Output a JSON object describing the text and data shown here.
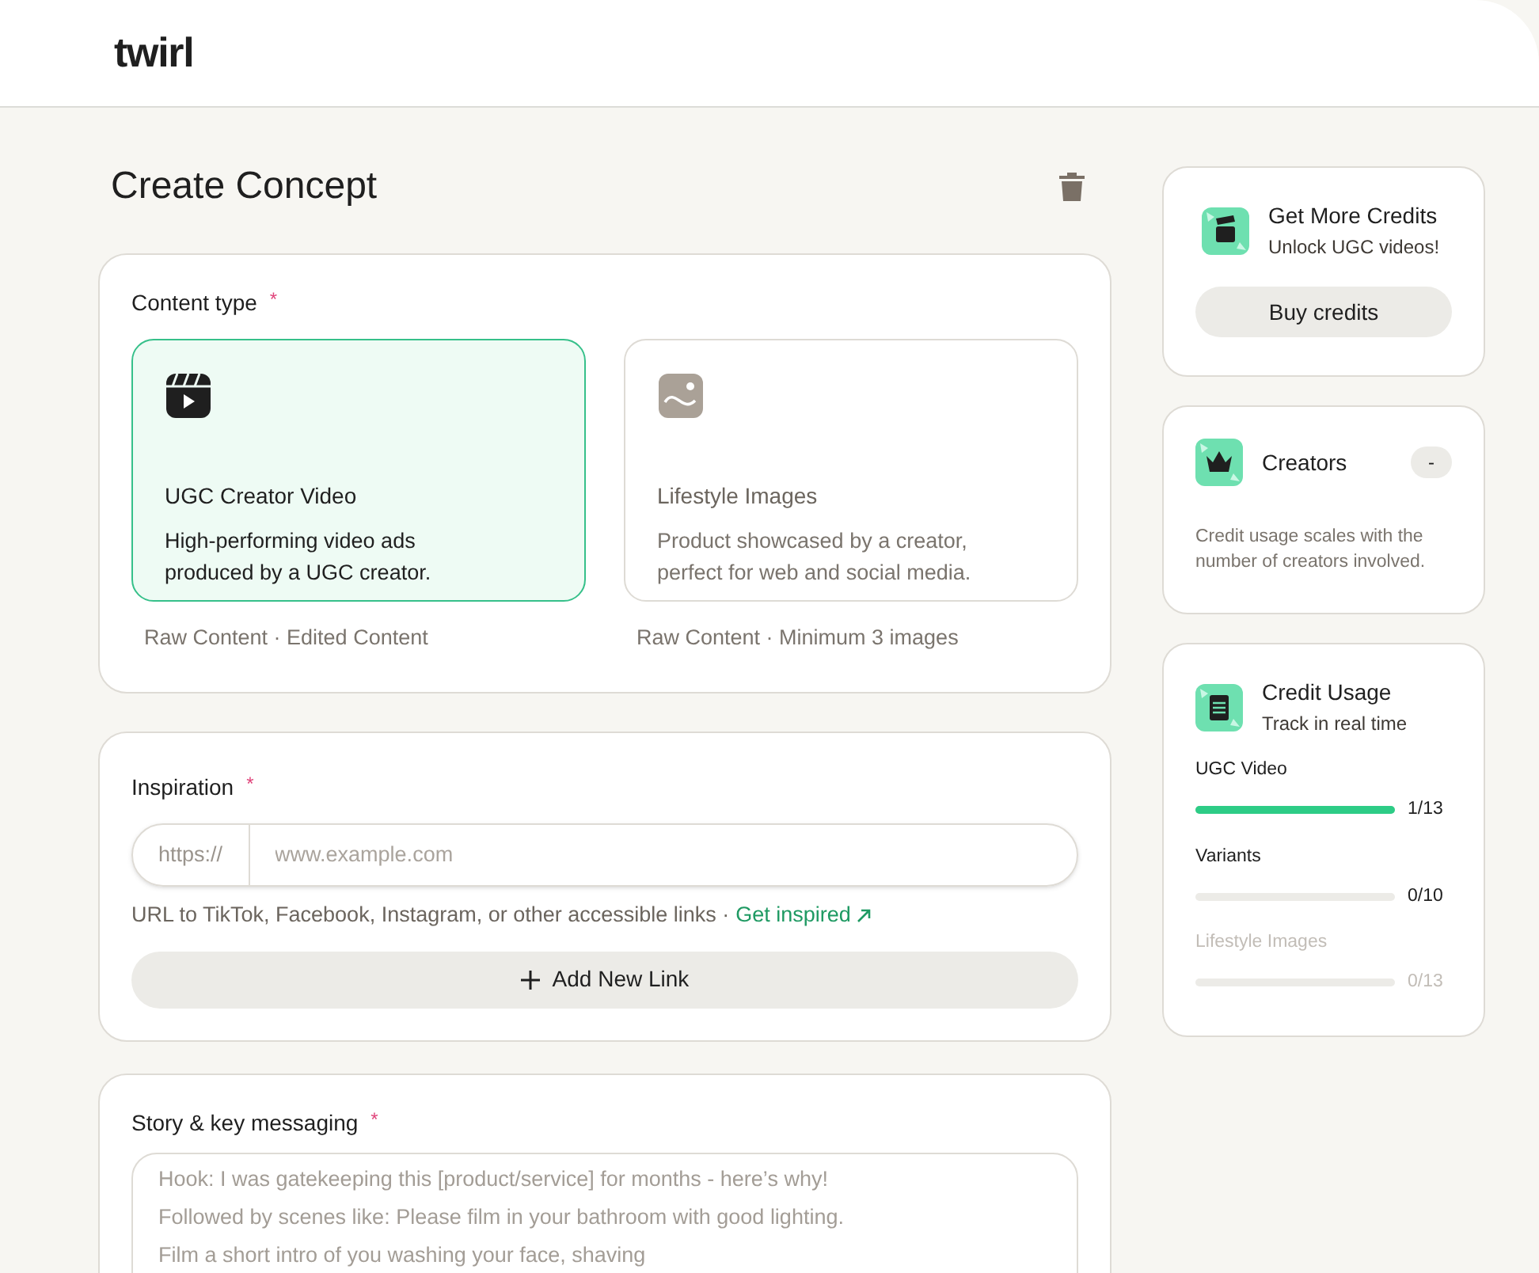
{
  "header": {
    "logo": "twirl"
  },
  "page": {
    "title": "Create Concept"
  },
  "content_type": {
    "label": "Content type",
    "required_mark": "*",
    "options": [
      {
        "kind": "video",
        "title": "UGC Creator Video",
        "description": "High-performing video ads produced by a UGC creator.",
        "footer": "Raw Content · Edited Content",
        "selected": true
      },
      {
        "kind": "image",
        "title": "Lifestyle Images",
        "description": "Product showcased by a creator, perfect for web and social media.",
        "footer": "Raw Content · Minimum 3 images",
        "selected": false
      }
    ]
  },
  "inspiration": {
    "label": "Inspiration",
    "required_mark": "*",
    "prefix": "https://",
    "placeholder": "www.example.com",
    "hint": "URL to TikTok, Facebook, Instagram, or other accessible links ·",
    "link": "Get inspired",
    "add_button": "Add New Link"
  },
  "story": {
    "label": "Story & key messaging",
    "required_mark": "*",
    "placeholder": "Hook: I was gatekeeping this [product/service] for months - here’s why!\nFollowed by scenes like: Please film in your bathroom with good lighting.\nFilm a short intro of you washing your face, shaving"
  },
  "credits_card": {
    "title": "Get More Credits",
    "subtitle": "Unlock UGC videos!",
    "button": "Buy credits"
  },
  "creators_card": {
    "title": "Creators",
    "badge": "-",
    "note": "Credit usage scales with the number of creators involved."
  },
  "usage_card": {
    "title": "Credit Usage",
    "subtitle": "Track in real time",
    "meters": [
      {
        "label": "UGC Video",
        "reading": "1/13",
        "level": 1,
        "disabled": false
      },
      {
        "label": "Variants",
        "reading": "0/10",
        "level": 0,
        "disabled": false
      },
      {
        "label": "Lifestyle Images",
        "reading": "0/13",
        "level": 0,
        "disabled": true
      }
    ]
  }
}
